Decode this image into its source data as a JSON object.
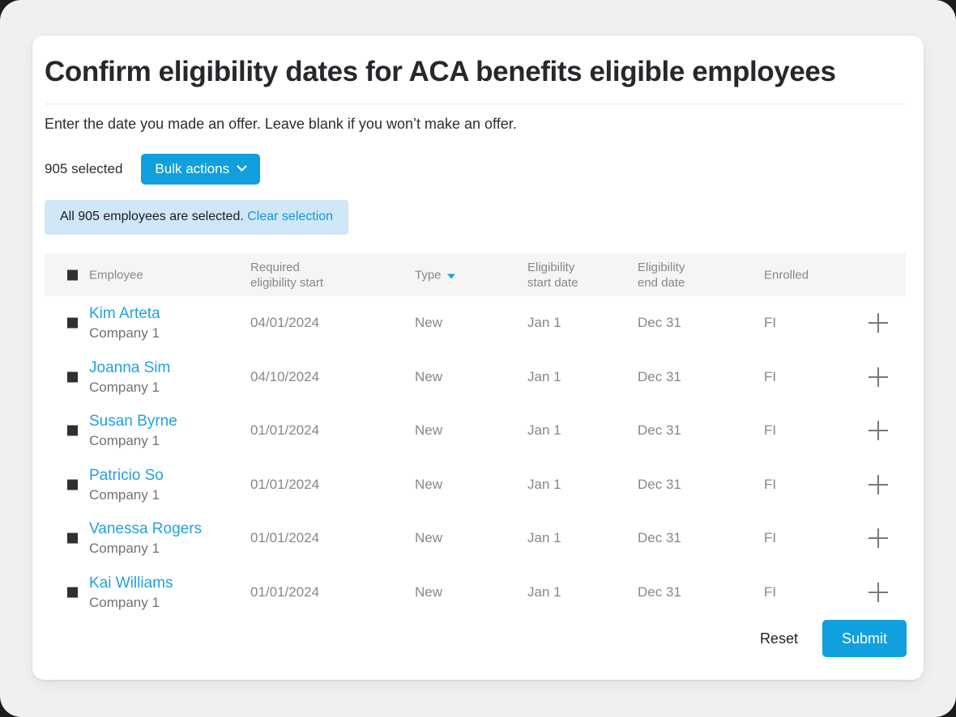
{
  "page": {
    "title": "Confirm eligibility dates for ACA benefits eligible employees",
    "subtitle": "Enter the date you made an offer. Leave blank if you won’t make an offer.",
    "accent_color": "#10a0dd",
    "link_color": "#22a0e0",
    "background_color": "#f0f0f0",
    "card_color": "#ffffff"
  },
  "selection": {
    "count_label": "905 selected",
    "bulk_actions_label": "Bulk actions",
    "bulk_actions_icon": "chevron-down-icon",
    "banner_text": "All 905 employees are selected.",
    "banner_link": "Clear selection",
    "banner_color": "#cfe7f6"
  },
  "table": {
    "select_all_checked": true,
    "headers": {
      "employee": "Employee",
      "required_eligibility_start": "Required\neligibility start",
      "required_line1": "Required",
      "required_line2": "eligibility start",
      "type": "Type",
      "type_sort_icon": "sort-descending-arrow-icon",
      "eligibility_start_line1": "Eligibility",
      "eligibility_start_line2": "start date",
      "eligibility_end_line1": "Eligibility",
      "eligibility_end_line2": "end date",
      "enrolled": "Enrolled"
    },
    "rows": [
      {
        "name": "Kim Arteta",
        "company": "Company 1",
        "required_eligibility_start": "04/01/2024",
        "type": "New",
        "eligibility_start_date": "Jan 1",
        "eligibility_end_date": "Dec 31",
        "enrolled": "FI",
        "action_icon": "plus-icon",
        "checked": true
      },
      {
        "name": "Joanna Sim",
        "company": "Company 1",
        "required_eligibility_start": "04/10/2024",
        "type": "New",
        "eligibility_start_date": "Jan 1",
        "eligibility_end_date": "Dec 31",
        "enrolled": "FI",
        "action_icon": "plus-icon",
        "checked": true
      },
      {
        "name": "Susan Byrne",
        "company": "Company 1",
        "required_eligibility_start": "01/01/2024",
        "type": "New",
        "eligibility_start_date": "Jan 1",
        "eligibility_end_date": "Dec 31",
        "enrolled": "FI",
        "action_icon": "plus-icon",
        "checked": true
      },
      {
        "name": "Patricio So",
        "company": "Company 1",
        "required_eligibility_start": "01/01/2024",
        "type": "New",
        "eligibility_start_date": "Jan 1",
        "eligibility_end_date": "Dec 31",
        "enrolled": "FI",
        "action_icon": "plus-icon",
        "checked": true
      },
      {
        "name": "Vanessa Rogers",
        "company": "Company 1",
        "required_eligibility_start": "01/01/2024",
        "type": "New",
        "eligibility_start_date": "Jan 1",
        "eligibility_end_date": "Dec 31",
        "enrolled": "FI",
        "action_icon": "plus-icon",
        "checked": true
      },
      {
        "name": "Kai Williams",
        "company": "Company 1",
        "required_eligibility_start": "01/01/2024",
        "type": "New",
        "eligibility_start_date": "Jan 1",
        "eligibility_end_date": "Dec 31",
        "enrolled": "FI",
        "action_icon": "plus-icon",
        "checked": true
      }
    ]
  },
  "footer": {
    "reset_label": "Reset",
    "submit_label": "Submit"
  }
}
